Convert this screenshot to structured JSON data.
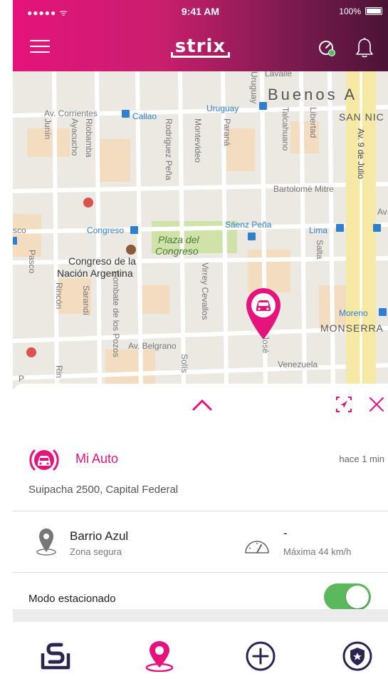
{
  "status_bar": {
    "carrier": "●●●●● ᯤ",
    "time": "9:41 AM",
    "battery": "100%"
  },
  "header": {
    "logo": "strix",
    "brand_color": "#e5137b",
    "icons": [
      "menu-icon",
      "speedometer-alert-icon",
      "bell-icon"
    ]
  },
  "map": {
    "streets": {
      "corrientes": "Av. Corrientes",
      "callao": "Callao",
      "uruguay": "Uruguay",
      "lavalle": "Lavalle",
      "uruguay_v": "Uruguay",
      "junin": "Junín",
      "ayacucho": "Ayacucho",
      "riobamba": "Riobamba",
      "rodriguez_pena": "Rodríguez Peña",
      "montevideo": "Montevideo",
      "parana": "Paraná",
      "talcahuano": "Talcahuano",
      "libertad": "Libertad",
      "nueve_de_julio": "Av. 9 de Julio",
      "bartolome_mitre": "Bartolomé Mitre",
      "av": "Av",
      "congreso": "Congreso",
      "saenz_pena": "Sáenz Peña",
      "lima": "Lima",
      "salta": "Salta",
      "sco": "sco",
      "pasco": "Pasco",
      "rincon": "Rincón",
      "sarandi": "Sarandí",
      "combate": "Combate de los Pozos",
      "virrey_cevallos": "Virrey Cevallos",
      "moreno": "Moreno",
      "belgrano": "Av. Belgrano",
      "solis": "Solís",
      "jose": "José",
      "venezuela": "Venezuela",
      "rin": "Rin",
      "p": "P"
    },
    "places": {
      "buenos_aires": "Buenos A",
      "san_nic": "SAN NIC",
      "congreso_nacion": "Congreso de la",
      "congreso_nacion2": "Nación Argentina",
      "plaza_del": "Plaza del",
      "plaza_congreso": "Congreso",
      "monserrat": "MONSERRA"
    },
    "markers": [
      "car-location-pin",
      "hospital-marker",
      "metro-marker"
    ]
  },
  "vehicle": {
    "name": "Mi Auto",
    "last_update": "hace 1 min",
    "address": "Suipacha 2500, Capital Federal"
  },
  "zone": {
    "name": "Barrio Azul",
    "status": "Zona segura"
  },
  "speed": {
    "current": "-",
    "max_label": "Máxima 44 km/h"
  },
  "parking": {
    "label": "Modo estacionado",
    "enabled": true,
    "toggle_color": "#5cb85c"
  },
  "tabbar": {
    "items": [
      "strix-home-icon",
      "location-icon",
      "add-icon",
      "shield-icon"
    ],
    "active": "location-icon"
  }
}
